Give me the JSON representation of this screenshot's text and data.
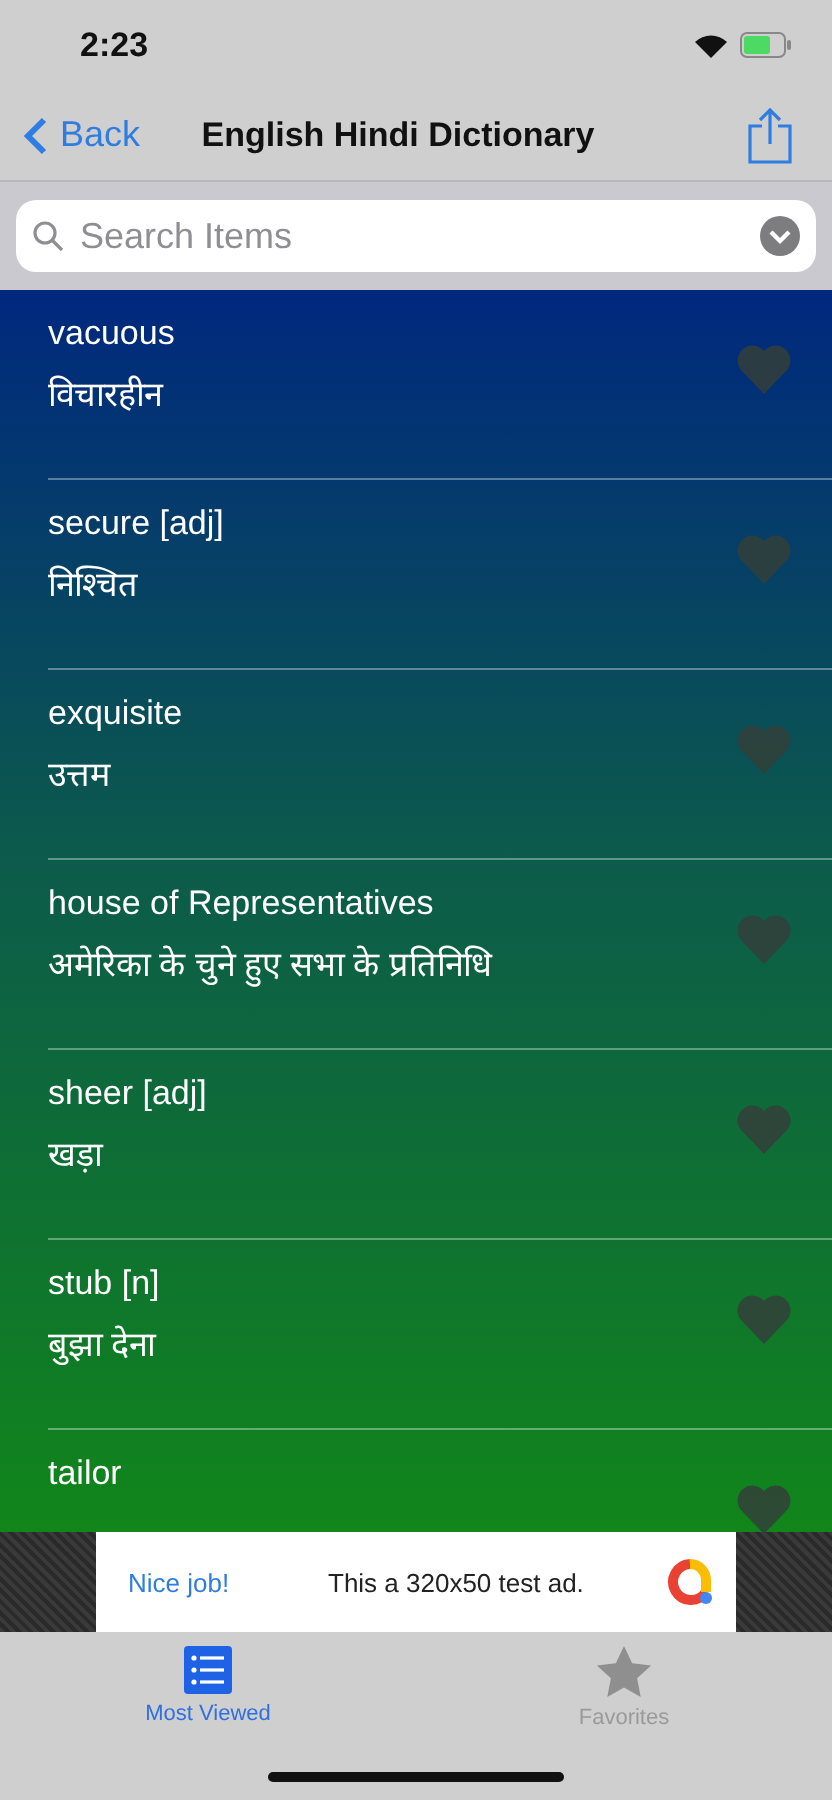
{
  "status_bar": {
    "time": "2:23"
  },
  "nav": {
    "back": "Back",
    "title": "English Hindi Dictionary"
  },
  "search": {
    "placeholder": "Search Items"
  },
  "entries": [
    {
      "word": "vacuous",
      "meaning": "विचारहीन"
    },
    {
      "word": "secure [adj]",
      "meaning": "निश्चित"
    },
    {
      "word": "exquisite",
      "meaning": "उत्तम"
    },
    {
      "word": "house of Representatives",
      "meaning": "अमेरिका के चुने हुए सभा के प्रतिनिधि"
    },
    {
      "word": "sheer [adj]",
      "meaning": "खड़ा"
    },
    {
      "word": "stub [n]",
      "meaning": "बुझा देना"
    },
    {
      "word": "tailor"
    }
  ],
  "ad": {
    "headline": "Nice job!",
    "text": "This a 320x50 test ad."
  },
  "tabs": [
    {
      "label": "Most Viewed",
      "selected": true,
      "kind": "list"
    },
    {
      "label": "Favorites",
      "selected": false,
      "kind": "star"
    }
  ]
}
